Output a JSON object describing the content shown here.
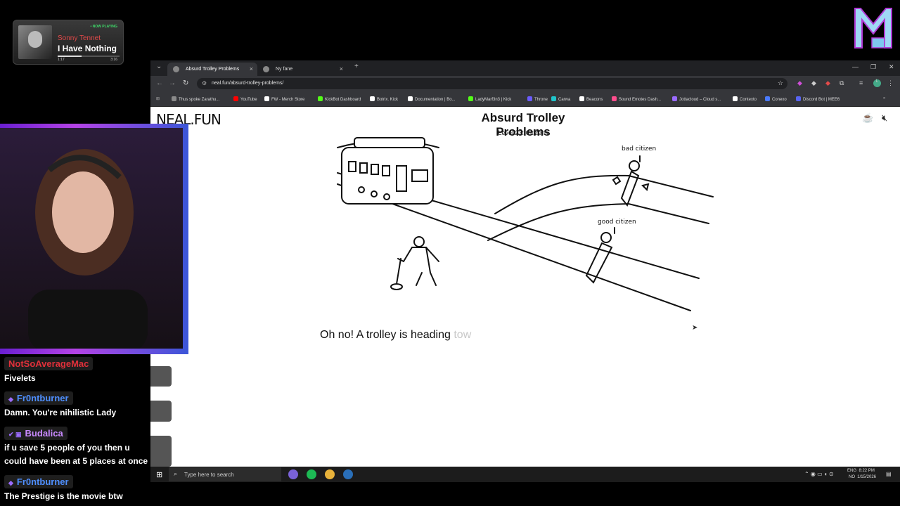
{
  "now_playing": {
    "badge": "• NOW PLAYING",
    "artist": "Sonny Tennet",
    "song": "I Have Nothing",
    "elapsed": "1:17",
    "duration": "3:16",
    "progress": 0.39
  },
  "browser": {
    "tabs": [
      {
        "label": "Absurd Trolley Problems",
        "active": true
      },
      {
        "label": "Ny fane",
        "active": false
      }
    ],
    "new_tab": "+",
    "url": "neal.fun/absurd-trolley-problems/",
    "bookmarks": [
      {
        "label": "Thus spoke Zarathu...",
        "color": "#8a8a8a"
      },
      {
        "label": "YouTube",
        "color": "#ff0000"
      },
      {
        "label": "FW - Merch Store",
        "color": "#ffffff"
      },
      {
        "label": "KickBot Dashboard",
        "color": "#53fc18"
      },
      {
        "label": "Botrix. Kick",
        "color": "#ffffff"
      },
      {
        "label": "Documentation | Bo...",
        "color": "#ffffff"
      },
      {
        "label": "LadyMarf3n3 | Kick",
        "color": "#53fc18"
      },
      {
        "label": "Throne",
        "color": "#6b5cff"
      },
      {
        "label": "Canva",
        "color": "#20c4cb"
      },
      {
        "label": "Beacons",
        "color": "#ffffff"
      },
      {
        "label": "Sound Emotes Dash...",
        "color": "#ff4d8d"
      },
      {
        "label": "Jottacloud – Cloud s...",
        "color": "#9a6bff"
      },
      {
        "label": "Contexto",
        "color": "#ffffff"
      },
      {
        "label": "Conexo",
        "color": "#4a7bff"
      },
      {
        "label": "Discord Bot | MEE6",
        "color": "#5865f2"
      }
    ]
  },
  "page": {
    "site_logo": "NEAL.FUN",
    "title": "Absurd Trolley Problems",
    "level": "Level 23: Citizens",
    "label_bad": "bad citizen",
    "label_good": "good citizen",
    "caption_visible": "Oh no! A trolley is heading ",
    "caption_fading": "tow"
  },
  "chat": [
    {
      "user": "NotSoAverageMac",
      "user_color": "#e0303a",
      "text": "Fivelets",
      "badges": ""
    },
    {
      "user": "Fr0ntburner",
      "user_color": "#4f8fff",
      "text": "Damn. You're nihilistic Lady",
      "badges": "◆"
    },
    {
      "user": "Budalica",
      "user_color": "#c98aff",
      "text": "if u save 5 people of you then u could have been at 5 places at once",
      "badges": "✔ ▣"
    },
    {
      "user": "Fr0ntburner",
      "user_color": "#4f8fff",
      "text": "The Prestige is the movie btw",
      "badges": "◆"
    }
  ],
  "taskbar": {
    "search_placeholder": "Type here to search",
    "lang_top": "ENG",
    "lang_bottom": "NO",
    "time": "8:22 PM",
    "date": "1/15/2026"
  }
}
